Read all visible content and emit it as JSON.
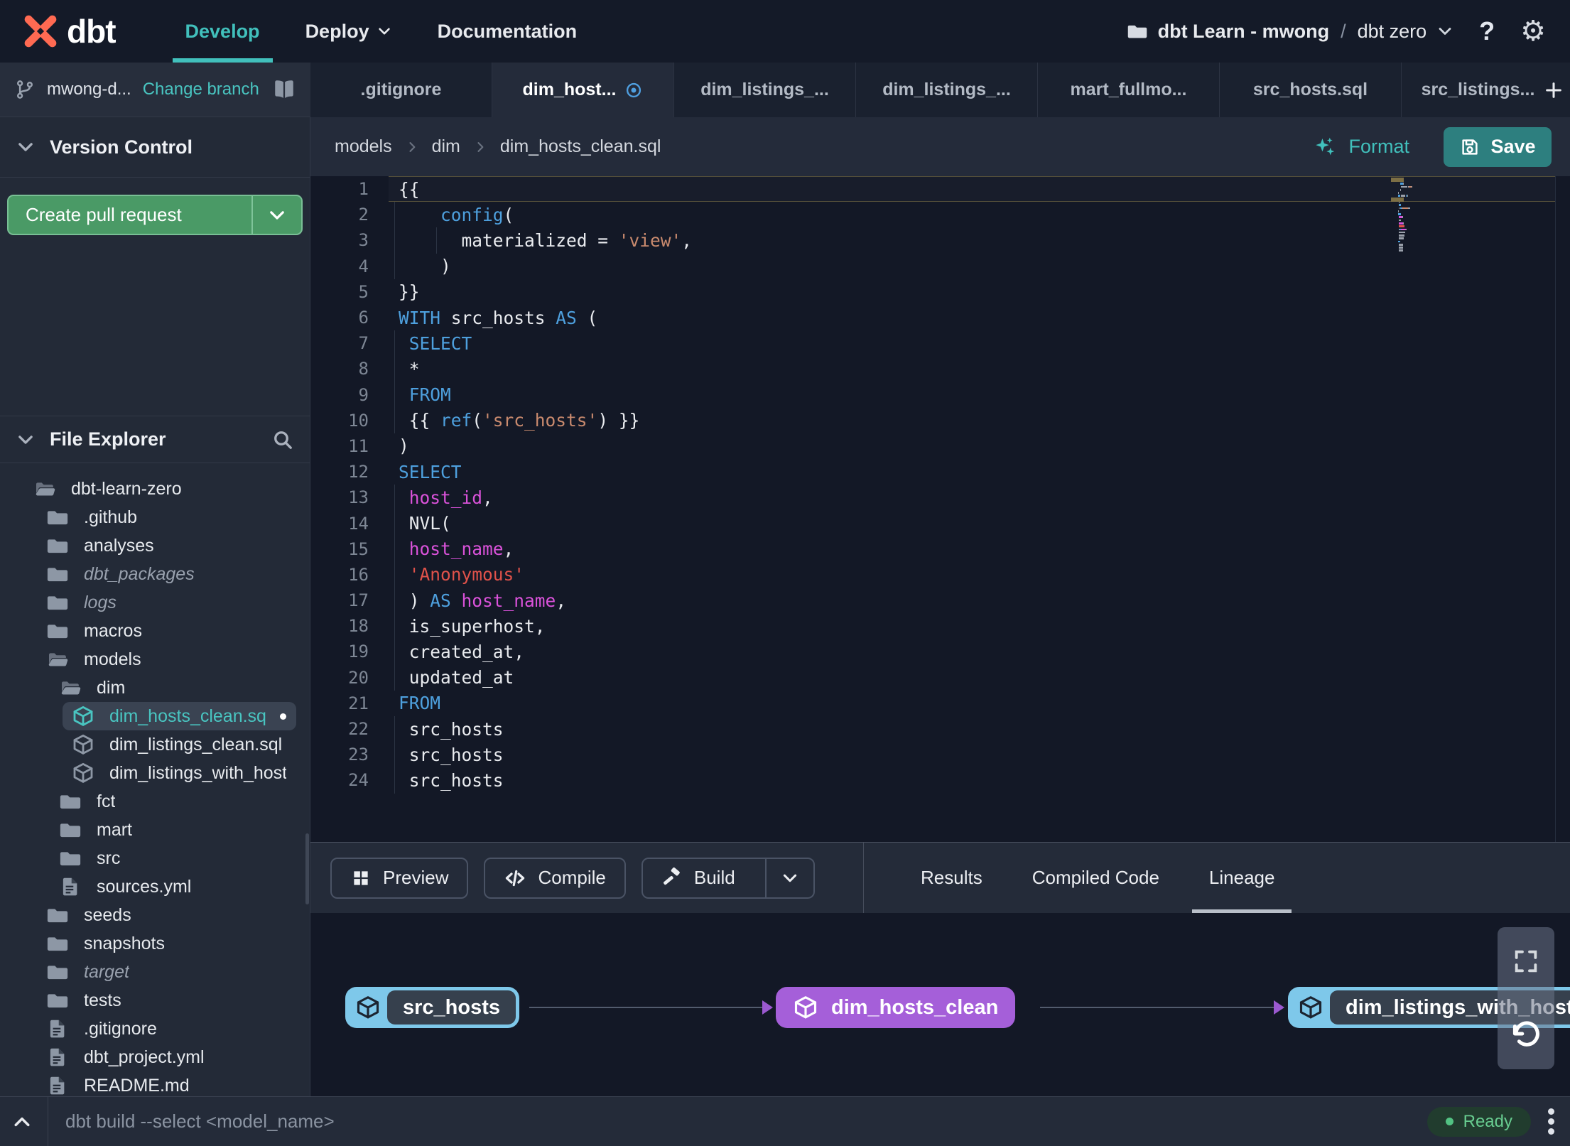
{
  "topnav": {
    "logo_text": "dbt",
    "nav": [
      {
        "label": "Develop",
        "active": true
      },
      {
        "label": "Deploy",
        "caret": true
      },
      {
        "label": "Documentation"
      }
    ],
    "project_name": "dbt Learn - mwong",
    "project_separator": "/",
    "environment": "dbt zero",
    "help_label": "?"
  },
  "branch_bar": {
    "branch_label": "mwong-d...",
    "change_branch_label": "Change branch"
  },
  "tab_bar": {
    "tabs": [
      {
        "label": ".gitignore"
      },
      {
        "label": "dim_host...",
        "active": true,
        "modified": true
      },
      {
        "label": "dim_listings_..."
      },
      {
        "label": "dim_listings_..."
      },
      {
        "label": "mart_fullmo..."
      },
      {
        "label": "src_hosts.sql"
      },
      {
        "label": "src_listings...",
        "clipped": true
      }
    ]
  },
  "breadcrumb": {
    "items": [
      "models",
      "dim",
      "dim_hosts_clean.sql"
    ]
  },
  "editor_actions": {
    "format_label": "Format",
    "save_label": "Save"
  },
  "editor": {
    "language": "sql",
    "current_line": 1,
    "lines": [
      {
        "n": 1,
        "tokens": [
          [
            "p",
            "{{"
          ]
        ]
      },
      {
        "n": 2,
        "g": [
          0
        ],
        "tokens": [
          [
            "p",
            "    "
          ],
          [
            "k",
            "config"
          ],
          [
            "p",
            "("
          ]
        ]
      },
      {
        "n": 3,
        "g": [
          0,
          4
        ],
        "tokens": [
          [
            "p",
            "      materialized = "
          ],
          [
            "s",
            "'view'"
          ],
          [
            "p",
            ","
          ]
        ]
      },
      {
        "n": 4,
        "g": [
          0
        ],
        "tokens": [
          [
            "p",
            "    )"
          ]
        ]
      },
      {
        "n": 5,
        "tokens": [
          [
            "p",
            "}}"
          ]
        ]
      },
      {
        "n": 6,
        "tokens": [
          [
            "k",
            "WITH"
          ],
          [
            "p",
            " src_hosts "
          ],
          [
            "k",
            "AS"
          ],
          [
            "p",
            " ("
          ]
        ]
      },
      {
        "n": 7,
        "g": [
          0
        ],
        "tokens": [
          [
            "p",
            " "
          ],
          [
            "k",
            "SELECT"
          ]
        ]
      },
      {
        "n": 8,
        "g": [
          0
        ],
        "tokens": [
          [
            "p",
            " *"
          ]
        ]
      },
      {
        "n": 9,
        "g": [
          0
        ],
        "tokens": [
          [
            "p",
            " "
          ],
          [
            "k",
            "FROM"
          ]
        ]
      },
      {
        "n": 10,
        "g": [
          0
        ],
        "tokens": [
          [
            "p",
            " {{ "
          ],
          [
            "k",
            "ref"
          ],
          [
            "p",
            "("
          ],
          [
            "s",
            "'src_hosts'"
          ],
          [
            "p",
            ") }}"
          ]
        ]
      },
      {
        "n": 11,
        "tokens": [
          [
            "p",
            ")"
          ]
        ]
      },
      {
        "n": 12,
        "tokens": [
          [
            "k",
            "SELECT"
          ]
        ]
      },
      {
        "n": 13,
        "g": [
          0
        ],
        "tokens": [
          [
            "p",
            " "
          ],
          [
            "m",
            "host_id"
          ],
          [
            "p",
            ","
          ]
        ]
      },
      {
        "n": 14,
        "g": [
          0
        ],
        "tokens": [
          [
            "p",
            " NVL("
          ]
        ]
      },
      {
        "n": 15,
        "g": [
          0
        ],
        "tokens": [
          [
            "p",
            " "
          ],
          [
            "m",
            "host_name"
          ],
          [
            "p",
            ","
          ]
        ]
      },
      {
        "n": 16,
        "g": [
          0
        ],
        "tokens": [
          [
            "p",
            " "
          ],
          [
            "r",
            "'Anonymous'"
          ]
        ]
      },
      {
        "n": 17,
        "g": [
          0
        ],
        "tokens": [
          [
            "p",
            " ) "
          ],
          [
            "k",
            "AS"
          ],
          [
            "p",
            " "
          ],
          [
            "m",
            "host_name"
          ],
          [
            "p",
            ","
          ]
        ]
      },
      {
        "n": 18,
        "g": [
          0
        ],
        "tokens": [
          [
            "p",
            " is_superhost,"
          ]
        ]
      },
      {
        "n": 19,
        "g": [
          0
        ],
        "tokens": [
          [
            "p",
            " created_at,"
          ]
        ]
      },
      {
        "n": 20,
        "g": [
          0
        ],
        "tokens": [
          [
            "p",
            " updated_at"
          ]
        ]
      },
      {
        "n": 21,
        "tokens": [
          [
            "k",
            "FROM"
          ]
        ]
      },
      {
        "n": 22,
        "g": [
          0
        ],
        "tokens": [
          [
            "p",
            " src_hosts"
          ]
        ]
      },
      {
        "n": 23,
        "g": [
          0
        ],
        "tokens": [
          [
            "p",
            " src_hosts"
          ]
        ]
      },
      {
        "n": 24,
        "g": [
          0
        ],
        "tokens": [
          [
            "p",
            " src_hosts"
          ]
        ]
      }
    ]
  },
  "version_control": {
    "title": "Version Control",
    "create_pr_label": "Create pull request"
  },
  "file_explorer": {
    "title": "File Explorer",
    "tree": [
      {
        "label": "dbt-learn-zero",
        "icon": "folder-open",
        "level": 0
      },
      {
        "label": ".github",
        "icon": "folder",
        "level": 1
      },
      {
        "label": "analyses",
        "icon": "folder",
        "level": 1
      },
      {
        "label": "dbt_packages",
        "icon": "folder",
        "level": 1,
        "italic": true
      },
      {
        "label": "logs",
        "icon": "folder",
        "level": 1,
        "italic": true
      },
      {
        "label": "macros",
        "icon": "folder",
        "level": 1
      },
      {
        "label": "models",
        "icon": "folder-open",
        "level": 1
      },
      {
        "label": "dim",
        "icon": "folder-open",
        "level": 2
      },
      {
        "label": "dim_hosts_clean.sql",
        "icon": "model",
        "level": 3,
        "selected": true,
        "modified": true
      },
      {
        "label": "dim_listings_clean.sql",
        "icon": "model",
        "level": 3
      },
      {
        "label": "dim_listings_with_hosts...",
        "icon": "model",
        "level": 3
      },
      {
        "label": "fct",
        "icon": "folder",
        "level": 2
      },
      {
        "label": "mart",
        "icon": "folder",
        "level": 2
      },
      {
        "label": "src",
        "icon": "folder",
        "level": 2
      },
      {
        "label": "sources.yml",
        "icon": "file",
        "level": 2
      },
      {
        "label": "seeds",
        "icon": "folder",
        "level": 1
      },
      {
        "label": "snapshots",
        "icon": "folder",
        "level": 1
      },
      {
        "label": "target",
        "icon": "folder",
        "level": 1,
        "italic": true
      },
      {
        "label": "tests",
        "icon": "folder",
        "level": 1
      },
      {
        "label": ".gitignore",
        "icon": "file",
        "level": 1
      },
      {
        "label": "dbt_project.yml",
        "icon": "file",
        "level": 1
      },
      {
        "label": "README.md",
        "icon": "file",
        "level": 1
      }
    ]
  },
  "result_panel": {
    "buttons": [
      {
        "label": "Preview",
        "icon": "preview"
      },
      {
        "label": "Compile",
        "icon": "code"
      },
      {
        "label": "Build",
        "icon": "hammer",
        "split": true
      }
    ],
    "tabs": [
      {
        "label": "Results"
      },
      {
        "label": "Compiled Code"
      },
      {
        "label": "Lineage",
        "active": true
      }
    ]
  },
  "lineage": {
    "nodes": [
      {
        "label": "src_hosts",
        "type": "source"
      },
      {
        "label": "dim_hosts_clean",
        "type": "model"
      },
      {
        "label": "dim_listings_with_hosts",
        "type": "source",
        "clipped": true
      }
    ]
  },
  "command_bar": {
    "placeholder": "dbt build --select <model_name>",
    "status_label": "Ready"
  },
  "colors": {
    "accent_teal": "#41c0bc",
    "logo_orange": "#ff6a52",
    "pr_green": "#4a9a66",
    "save_teal": "#2d7f7f",
    "node_purple": "#a55fd9",
    "node_blue": "#7ec8ea",
    "status_green": "#52c283",
    "modified_blue": "#4f9fe0",
    "syntax_keyword": "#4ea0de",
    "syntax_string": "#c98a6e",
    "syntax_string_red": "#e0524a",
    "syntax_identifier": "#da52da"
  }
}
